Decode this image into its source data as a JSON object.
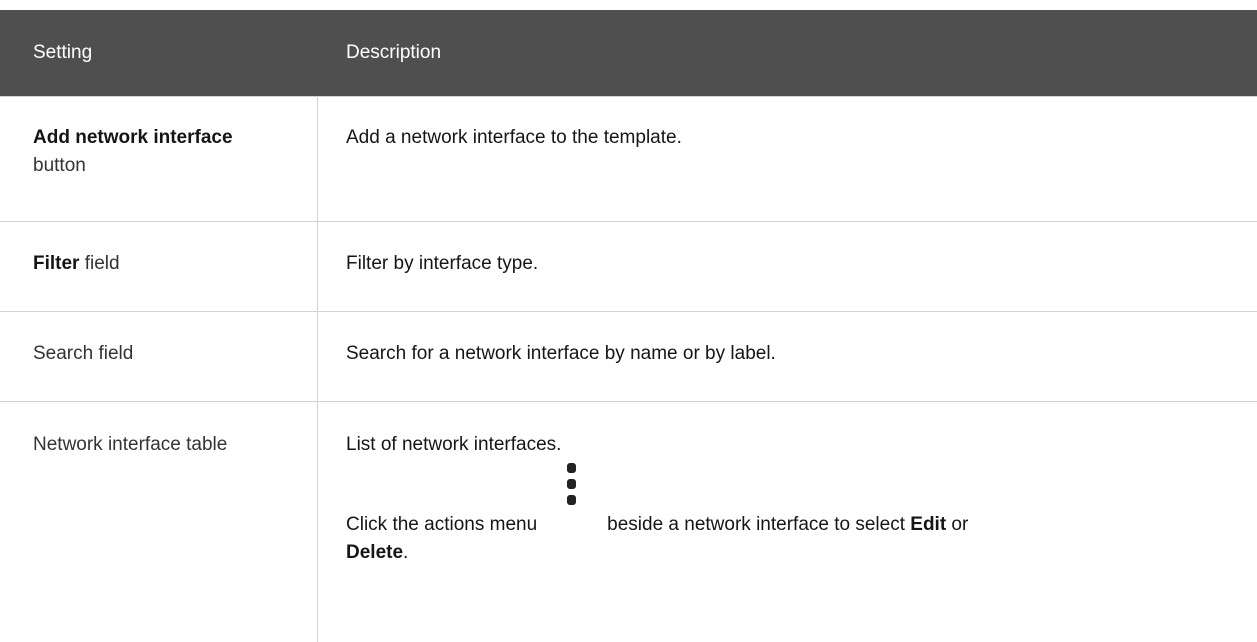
{
  "table": {
    "headers": {
      "setting": "Setting",
      "description": "Description"
    },
    "rows": [
      {
        "setting_bold": "Add network interface",
        "setting_rest": "button",
        "description": "Add a network interface to the template."
      },
      {
        "setting_bold": "Filter",
        "setting_rest": " field",
        "description": "Filter by interface type."
      },
      {
        "setting": "Search field",
        "description": "Search for a network interface by name or by label."
      },
      {
        "setting": "Network interface table",
        "description": "List of network interfaces.",
        "action_text_before": "Click the actions menu",
        "action_icon": "kebab-vertical-icon",
        "action_text_after": "beside a network interface to select ",
        "action_edit": "Edit",
        "action_or": " or",
        "action_delete": "Delete",
        "action_period": "."
      }
    ]
  }
}
